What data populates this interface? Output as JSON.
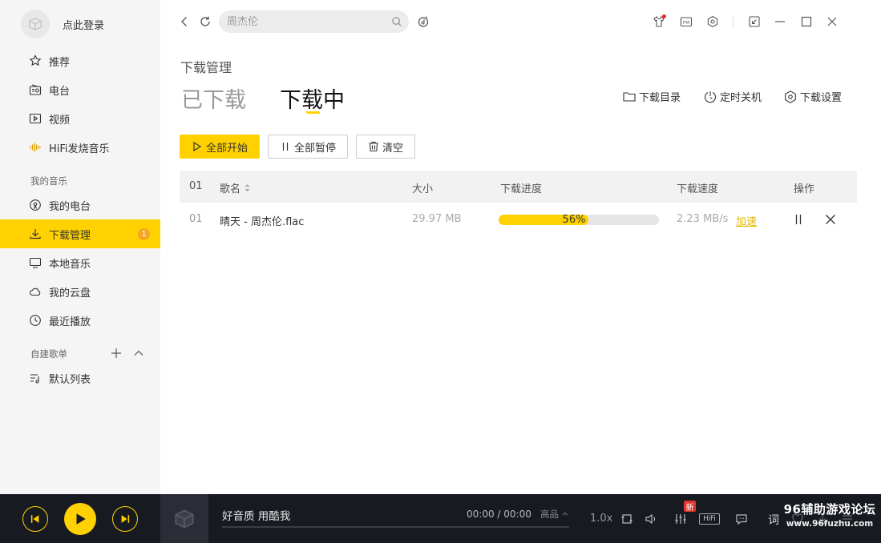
{
  "sidebar": {
    "login_text": "点此登录",
    "items": [
      {
        "label": "推荐"
      },
      {
        "label": "电台"
      },
      {
        "label": "视频"
      },
      {
        "label": "HiFi发烧音乐"
      }
    ],
    "my_music_label": "我的音乐",
    "my_music_items": [
      {
        "label": "我的电台"
      },
      {
        "label": "下载管理",
        "badge": "1"
      },
      {
        "label": "本地音乐"
      },
      {
        "label": "我的云盘"
      },
      {
        "label": "最近播放"
      }
    ],
    "playlist_label": "自建歌单",
    "playlist_items": [
      {
        "label": "默认列表"
      }
    ]
  },
  "topbar": {
    "search_placeholder": "周杰伦"
  },
  "main": {
    "page_title": "下载管理",
    "tabs": [
      {
        "label": "已下载"
      },
      {
        "label": "下载中"
      }
    ],
    "top_actions": [
      {
        "label": "下载目录"
      },
      {
        "label": "定时关机"
      },
      {
        "label": "下载设置"
      }
    ],
    "buttons": {
      "start_all": "全部开始",
      "pause_all": "全部暂停",
      "clear": "清空"
    },
    "table": {
      "headers": {
        "index": "01",
        "name": "歌名",
        "size": "大小",
        "progress": "下载进度",
        "speed": "下载速度",
        "ops": "操作"
      },
      "rows": [
        {
          "index": "01",
          "name": "晴天 - 周杰伦.flac",
          "size": "29.97 MB",
          "progress": 56,
          "progress_label": "56%",
          "speed": "2.23 MB/s",
          "speed_up": "加速"
        }
      ]
    }
  },
  "player": {
    "song_title": "好音质 用酷我",
    "time": "00:00 / 00:00",
    "quality": "高品",
    "speed": "1.0x",
    "new_badge": "新",
    "hifi": "HiFi",
    "lyric": "词",
    "watermark_title": "96辅助游戏论坛",
    "watermark_url": "www.96fuzhu.com"
  },
  "colors": {
    "accent": "#ffd100",
    "sidebar_bg": "#f5f5f5",
    "player_bg": "#171a21",
    "badge": "#f5a623"
  }
}
